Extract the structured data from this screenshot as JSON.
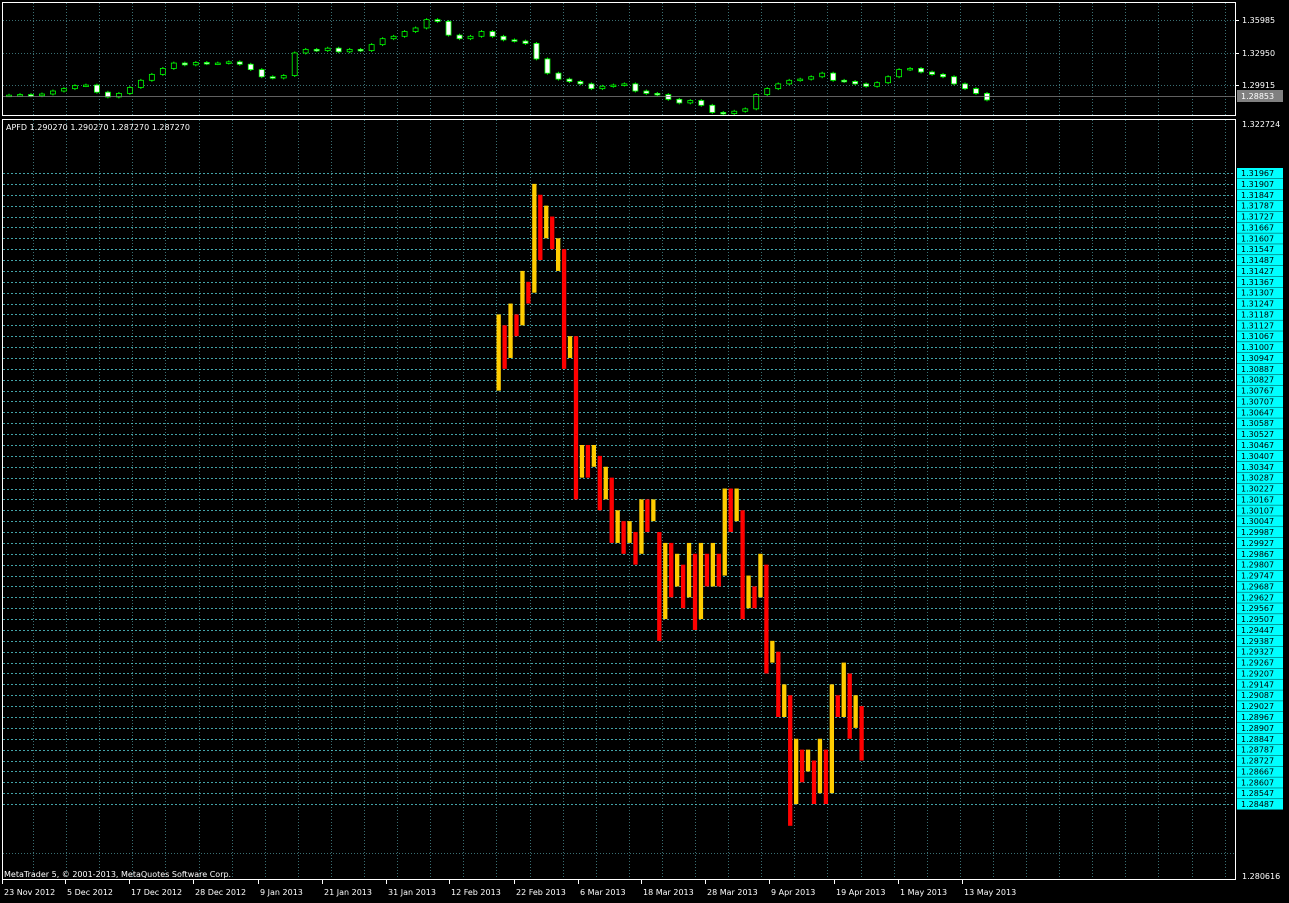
{
  "colors": {
    "background": "#000000",
    "frame": "#ffffff",
    "grid": "#3a6f73",
    "hline": "#59d9df",
    "price_tag": "#00ffff",
    "candle_up": "#00ff00",
    "candle_body_down": "#ffffff",
    "bar_up": "#ffcc00",
    "bar_down": "#ff0000",
    "current_price_bg": "#808080",
    "text": "#ffffff"
  },
  "panel_info": {
    "label": "APFD 1.290270 1.290270 1.287270 1.287270",
    "copyright": "MetaTrader 5, © 2001-2013, MetaQuotes Software Corp."
  },
  "chart_data": [
    {
      "type": "candlestick",
      "y_axis_labels": [
        "1.35985",
        "1.32950",
        "1.29915"
      ],
      "current_price": "1.28853",
      "ylim": [
        1.275,
        1.37
      ],
      "values": [
        1.2925,
        1.293,
        1.292,
        1.2935,
        1.296,
        1.298,
        1.3005,
        1.301,
        1.295,
        1.291,
        1.294,
        1.299,
        1.305,
        1.31,
        1.315,
        1.3195,
        1.318,
        1.32,
        1.319,
        1.3195,
        1.3205,
        1.3185,
        1.314,
        1.308,
        1.307,
        1.309,
        1.328,
        1.331,
        1.33,
        1.332,
        1.329,
        1.331,
        1.33,
        1.335,
        1.34,
        1.342,
        1.346,
        1.349,
        1.356,
        1.3545,
        1.343,
        1.34,
        1.342,
        1.346,
        1.342,
        1.339,
        1.338,
        1.336,
        1.323,
        1.311,
        1.306,
        1.304,
        1.302,
        1.298,
        1.3,
        1.301,
        1.302,
        1.296,
        1.294,
        1.293,
        1.289,
        1.286,
        1.288,
        1.284,
        1.278,
        1.277,
        1.279,
        1.281,
        1.293,
        1.298,
        1.302,
        1.305,
        1.306,
        1.308,
        1.311,
        1.305,
        1.304,
        1.302,
        1.3,
        1.303,
        1.308,
        1.314,
        1.315,
        1.312,
        1.31,
        1.308,
        1.302,
        1.298,
        1.294,
        1.2885
      ]
    },
    {
      "type": "bar",
      "y_axis_top": "1.322724",
      "y_axis_bottom": "1.280616",
      "ylim": [
        1.280616,
        1.322724
      ],
      "price_levels": [
        "1.31967",
        "1.31907",
        "1.31847",
        "1.31787",
        "1.31727",
        "1.31667",
        "1.31607",
        "1.31547",
        "1.31487",
        "1.31427",
        "1.31367",
        "1.31307",
        "1.31247",
        "1.31187",
        "1.31127",
        "1.31067",
        "1.31007",
        "1.30947",
        "1.30887",
        "1.30827",
        "1.30767",
        "1.30707",
        "1.30647",
        "1.30587",
        "1.30527",
        "1.30467",
        "1.30407",
        "1.30347",
        "1.30287",
        "1.30227",
        "1.30167",
        "1.30107",
        "1.30047",
        "1.29987",
        "1.29927",
        "1.29867",
        "1.29807",
        "1.29747",
        "1.29687",
        "1.29627",
        "1.29567",
        "1.29507",
        "1.29447",
        "1.29387",
        "1.29327",
        "1.29267",
        "1.29207",
        "1.29147",
        "1.29087",
        "1.29027",
        "1.28967",
        "1.28907",
        "1.28847",
        "1.28787",
        "1.28727",
        "1.28667",
        "1.28607",
        "1.28547",
        "1.28487"
      ],
      "x_labels": [
        "23 Nov 2012",
        "5 Dec 2012",
        "17 Dec 2012",
        "28 Dec 2012",
        "9 Jan 2013",
        "21 Jan 2013",
        "31 Jan 2013",
        "12 Feb 2013",
        "22 Feb 2013",
        "6 Mar 2013",
        "18 Mar 2013",
        "28 Mar 2013",
        "9 Apr 2013",
        "19 Apr 2013",
        "1 May 2013",
        "13 May 2013"
      ],
      "series": [
        {
          "color": "up",
          "values": [
            [
              1.30767,
              1.31187
            ],
            [
              1.31127,
              1.31487
            ],
            [
              1.31487,
              1.31907
            ]
          ]
        },
        {
          "color": "down",
          "values": [
            [
              1.30857,
              1.31127
            ],
            [
              1.31187,
              1.31367
            ],
            [
              1.31547,
              1.31847
            ]
          ]
        }
      ],
      "bars": [
        {
          "dir": "up",
          "low": 1.30767,
          "high": 1.31187
        },
        {
          "dir": "down",
          "low": 1.30887,
          "high": 1.31127
        },
        {
          "dir": "up",
          "low": 1.30947,
          "high": 1.31247
        },
        {
          "dir": "down",
          "low": 1.31067,
          "high": 1.31187
        },
        {
          "dir": "up",
          "low": 1.31127,
          "high": 1.31427
        },
        {
          "dir": "down",
          "low": 1.31247,
          "high": 1.31367
        },
        {
          "dir": "up",
          "low": 1.31307,
          "high": 1.31907
        },
        {
          "dir": "down",
          "low": 1.31487,
          "high": 1.31847
        },
        {
          "dir": "up",
          "low": 1.31607,
          "high": 1.31787
        },
        {
          "dir": "down",
          "low": 1.31547,
          "high": 1.31727
        },
        {
          "dir": "up",
          "low": 1.31427,
          "high": 1.31607
        },
        {
          "dir": "down",
          "low": 1.30887,
          "high": 1.31547
        },
        {
          "dir": "up",
          "low": 1.30947,
          "high": 1.31067
        },
        {
          "dir": "down",
          "low": 1.30167,
          "high": 1.31067
        },
        {
          "dir": "up",
          "low": 1.30287,
          "high": 1.30467
        },
        {
          "dir": "down",
          "low": 1.30287,
          "high": 1.30467
        },
        {
          "dir": "up",
          "low": 1.30347,
          "high": 1.30467
        },
        {
          "dir": "down",
          "low": 1.30107,
          "high": 1.30407
        },
        {
          "dir": "up",
          "low": 1.30167,
          "high": 1.30347
        },
        {
          "dir": "down",
          "low": 1.29927,
          "high": 1.30287
        },
        {
          "dir": "up",
          "low": 1.29927,
          "high": 1.30107
        },
        {
          "dir": "down",
          "low": 1.29867,
          "high": 1.30047
        },
        {
          "dir": "up",
          "low": 1.29927,
          "high": 1.30047
        },
        {
          "dir": "down",
          "low": 1.29807,
          "high": 1.29987
        },
        {
          "dir": "up",
          "low": 1.29867,
          "high": 1.30167
        },
        {
          "dir": "down",
          "low": 1.29987,
          "high": 1.30167
        },
        {
          "dir": "up",
          "low": 1.30047,
          "high": 1.30167
        },
        {
          "dir": "down",
          "low": 1.29387,
          "high": 1.29987
        },
        {
          "dir": "up",
          "low": 1.29507,
          "high": 1.29927
        },
        {
          "dir": "down",
          "low": 1.29627,
          "high": 1.29927
        },
        {
          "dir": "up",
          "low": 1.29687,
          "high": 1.29867
        },
        {
          "dir": "down",
          "low": 1.29567,
          "high": 1.29807
        },
        {
          "dir": "up",
          "low": 1.29627,
          "high": 1.29927
        },
        {
          "dir": "down",
          "low": 1.29447,
          "high": 1.29867
        },
        {
          "dir": "up",
          "low": 1.29507,
          "high": 1.29927
        },
        {
          "dir": "down",
          "low": 1.29687,
          "high": 1.29867
        },
        {
          "dir": "up",
          "low": 1.29687,
          "high": 1.29927
        },
        {
          "dir": "down",
          "low": 1.29687,
          "high": 1.29867
        },
        {
          "dir": "up",
          "low": 1.29747,
          "high": 1.30227
        },
        {
          "dir": "down",
          "low": 1.29987,
          "high": 1.30227
        },
        {
          "dir": "up",
          "low": 1.30047,
          "high": 1.30227
        },
        {
          "dir": "down",
          "low": 1.29507,
          "high": 1.30107
        },
        {
          "dir": "up",
          "low": 1.29567,
          "high": 1.29747
        },
        {
          "dir": "down",
          "low": 1.29567,
          "high": 1.29687
        },
        {
          "dir": "up",
          "low": 1.29627,
          "high": 1.29867
        },
        {
          "dir": "down",
          "low": 1.29207,
          "high": 1.29807
        },
        {
          "dir": "up",
          "low": 1.29267,
          "high": 1.29387
        },
        {
          "dir": "down",
          "low": 1.28967,
          "high": 1.29327
        },
        {
          "dir": "up",
          "low": 1.28967,
          "high": 1.29147
        },
        {
          "dir": "down",
          "low": 1.28367,
          "high": 1.29087
        },
        {
          "dir": "up",
          "low": 1.28487,
          "high": 1.28847
        },
        {
          "dir": "down",
          "low": 1.28607,
          "high": 1.28787
        },
        {
          "dir": "up",
          "low": 1.28667,
          "high": 1.28787
        },
        {
          "dir": "down",
          "low": 1.28487,
          "high": 1.28727
        },
        {
          "dir": "up",
          "low": 1.28547,
          "high": 1.28847
        },
        {
          "dir": "down",
          "low": 1.28487,
          "high": 1.28787
        },
        {
          "dir": "up",
          "low": 1.28547,
          "high": 1.29147
        },
        {
          "dir": "down",
          "low": 1.28967,
          "high": 1.29087
        },
        {
          "dir": "up",
          "low": 1.28967,
          "high": 1.29267
        },
        {
          "dir": "down",
          "low": 1.28847,
          "high": 1.29207
        },
        {
          "dir": "up",
          "low": 1.28907,
          "high": 1.29087
        },
        {
          "dir": "down",
          "low": 1.28727,
          "high": 1.29027
        }
      ]
    }
  ]
}
